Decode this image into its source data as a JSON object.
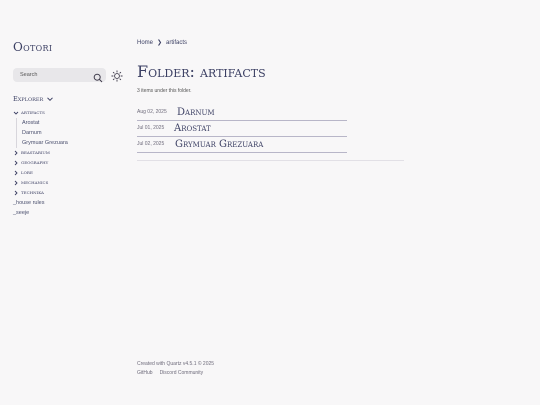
{
  "site": {
    "title": "Ootori"
  },
  "search": {
    "placeholder": "Search"
  },
  "explorer": {
    "title": "Explorer",
    "tree": [
      {
        "type": "folder",
        "label": "artifacts",
        "open": true,
        "children": [
          "Arostat",
          "Darnum",
          "Grymuar Grezuara"
        ]
      },
      {
        "type": "folder",
        "label": "beastarium",
        "open": false
      },
      {
        "type": "folder",
        "label": "geography",
        "open": false
      },
      {
        "type": "folder",
        "label": "lore",
        "open": false
      },
      {
        "type": "folder",
        "label": "mechanics",
        "open": false
      },
      {
        "type": "folder",
        "label": "technika",
        "open": false
      },
      {
        "type": "file",
        "label": "_house rules"
      },
      {
        "type": "file",
        "label": "_seeje"
      }
    ]
  },
  "breadcrumb": {
    "home": "Home",
    "separator": "❯",
    "current": "artifacts"
  },
  "page": {
    "title": "Folder: artifacts",
    "item_count": "3 items under this folder.",
    "items": [
      {
        "date": "Aug 02, 2025",
        "title": "Darnum"
      },
      {
        "date": "Jul 01, 2025",
        "title": "Arostat"
      },
      {
        "date": "Jul 02, 2025",
        "title": "Grymuar Grezuara"
      }
    ]
  },
  "footer": {
    "text": "Created with Quartz v4.5.1 © 2025",
    "links": [
      "GitHub",
      "Discord Community"
    ]
  },
  "colors": {
    "accent": "#3b3f63",
    "background": "#f8f7f8",
    "search_bg": "#e8e7ea"
  }
}
